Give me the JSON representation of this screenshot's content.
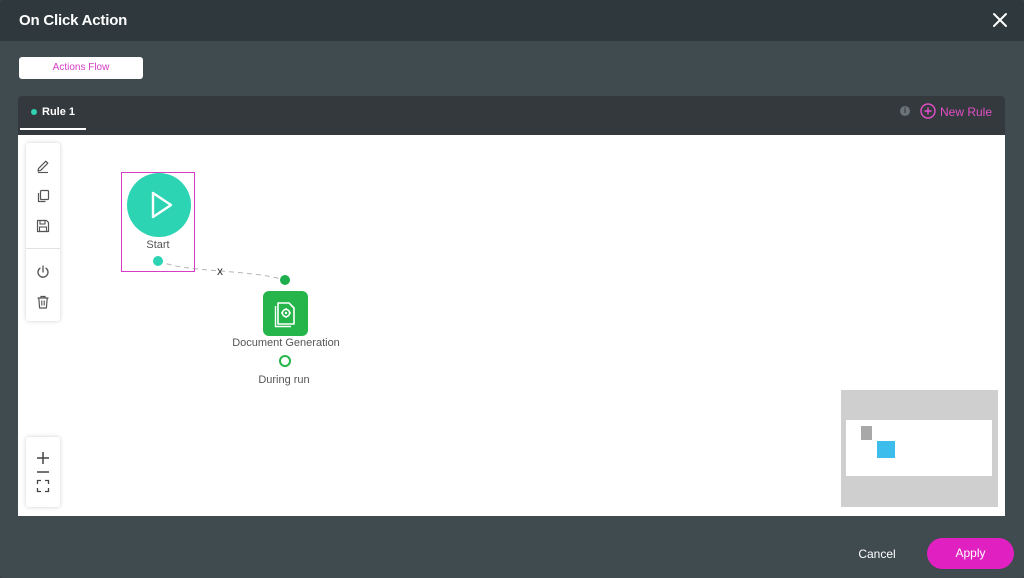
{
  "dialog": {
    "title": "On Click Action"
  },
  "tabs": {
    "actions_flow": "Actions Flow"
  },
  "rules": {
    "active_rule": "Rule 1",
    "info": "i",
    "new_rule_label": "New Rule"
  },
  "toolbar": {
    "items": [
      "edit-icon",
      "copy-icon",
      "save-icon",
      "power-icon",
      "trash-icon"
    ]
  },
  "zoom": {
    "items": [
      "zoom-in-icon",
      "fit-view-icon"
    ]
  },
  "flow": {
    "start_label": "Start",
    "link_remove": "x",
    "doc_node_label": "Document Generation",
    "doc_output_label": "During run"
  },
  "footer": {
    "cancel_label": "Cancel",
    "apply_label": "Apply"
  },
  "colors": {
    "accent": "#e020c0",
    "start_node": "#2dd4b3",
    "doc_node": "#25b54b",
    "minimap_node": "#3cbdec"
  }
}
